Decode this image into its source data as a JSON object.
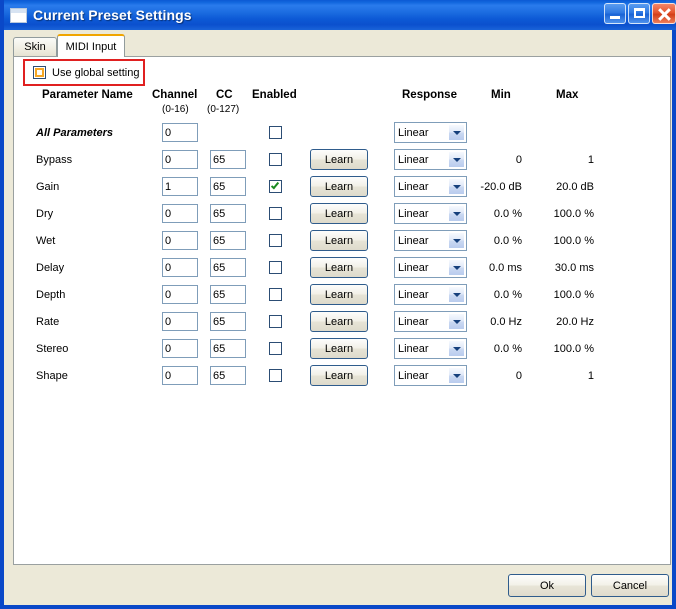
{
  "window": {
    "title": "Current Preset Settings",
    "icon": "window-icon",
    "controls": {
      "minimize": "minimize-button",
      "maximize": "maximize-button",
      "close": "close-button"
    }
  },
  "tabs": [
    {
      "label": "Skin",
      "selected": false
    },
    {
      "label": "MIDI Input",
      "selected": true
    }
  ],
  "global_setting": {
    "label": "Use global setting",
    "checked": false,
    "highlight_color": "#E02020",
    "checkbox_accent": "#F5A623"
  },
  "columns": {
    "parameter_name": "Parameter Name",
    "channel": "Channel",
    "channel_range": "(0-16)",
    "cc": "CC",
    "cc_range": "(0-127)",
    "enabled": "Enabled",
    "response": "Response",
    "min": "Min",
    "max": "Max"
  },
  "learn_label": "Learn",
  "rows": [
    {
      "name": "All Parameters",
      "all": true,
      "channel": "0",
      "cc": null,
      "enabled": false,
      "learn": false,
      "response": "Linear",
      "min": "",
      "max": ""
    },
    {
      "name": "Bypass",
      "all": false,
      "channel": "0",
      "cc": "65",
      "enabled": false,
      "learn": true,
      "response": "Linear",
      "min": "0",
      "max": "1"
    },
    {
      "name": "Gain",
      "all": false,
      "channel": "1",
      "cc": "65",
      "enabled": true,
      "learn": true,
      "response": "Linear",
      "min": "-20.0 dB",
      "max": "20.0 dB"
    },
    {
      "name": "Dry",
      "all": false,
      "channel": "0",
      "cc": "65",
      "enabled": false,
      "learn": true,
      "response": "Linear",
      "min": "0.0 %",
      "max": "100.0 %"
    },
    {
      "name": "Wet",
      "all": false,
      "channel": "0",
      "cc": "65",
      "enabled": false,
      "learn": true,
      "response": "Linear",
      "min": "0.0 %",
      "max": "100.0 %"
    },
    {
      "name": "Delay",
      "all": false,
      "channel": "0",
      "cc": "65",
      "enabled": false,
      "learn": true,
      "response": "Linear",
      "min": "0.0 ms",
      "max": "30.0 ms"
    },
    {
      "name": "Depth",
      "all": false,
      "channel": "0",
      "cc": "65",
      "enabled": false,
      "learn": true,
      "response": "Linear",
      "min": "0.0 %",
      "max": "100.0 %"
    },
    {
      "name": "Rate",
      "all": false,
      "channel": "0",
      "cc": "65",
      "enabled": false,
      "learn": true,
      "response": "Linear",
      "min": "0.0 Hz",
      "max": "20.0 Hz"
    },
    {
      "name": "Stereo",
      "all": false,
      "channel": "0",
      "cc": "65",
      "enabled": false,
      "learn": true,
      "response": "Linear",
      "min": "0.0 %",
      "max": "100.0 %"
    },
    {
      "name": "Shape",
      "all": false,
      "channel": "0",
      "cc": "65",
      "enabled": false,
      "learn": true,
      "response": "Linear",
      "min": "0",
      "max": "1"
    }
  ],
  "footer": {
    "ok_label": "Ok",
    "cancel_label": "Cancel"
  }
}
